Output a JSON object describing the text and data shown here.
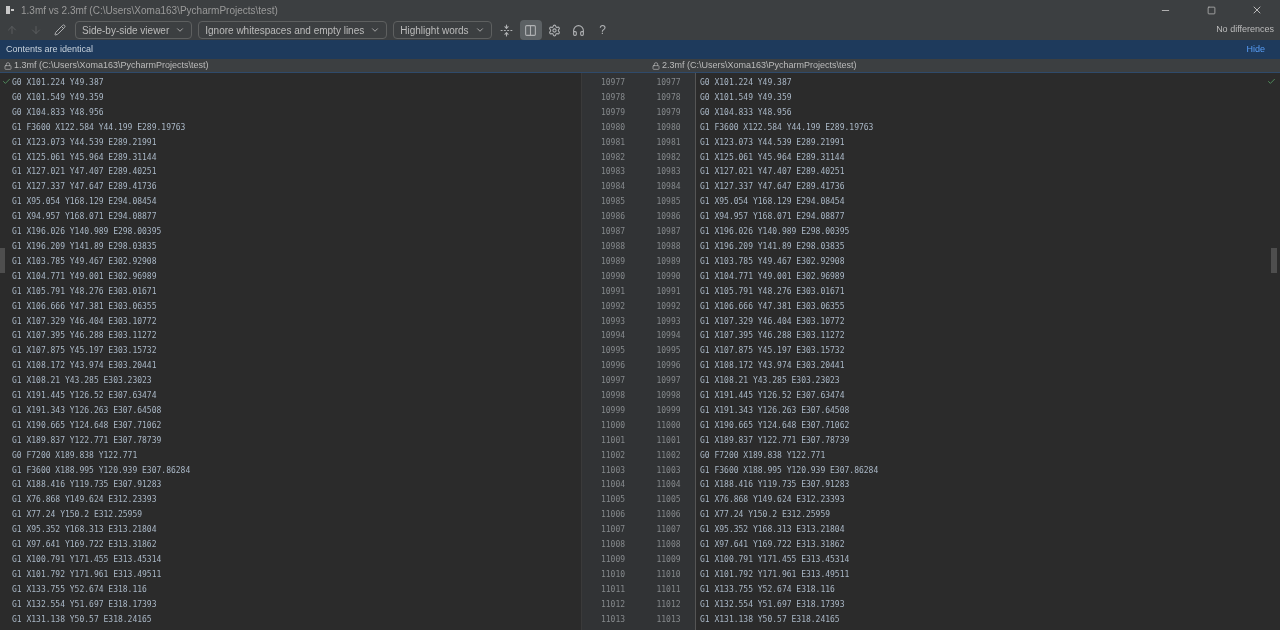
{
  "window": {
    "title": "1.3mf vs 2.3mf (C:\\Users\\Xoma163\\PycharmProjects\\test)"
  },
  "toolbar": {
    "items": [
      {
        "kind": "icon",
        "disabled": true
      },
      {
        "kind": "icon",
        "disabled": true
      },
      {
        "kind": "icon",
        "disabled": false
      },
      {
        "kind": "dropdown",
        "label": "Side-by-side viewer"
      },
      {
        "kind": "dropdown",
        "label": "Ignore whitespaces and empty lines"
      },
      {
        "kind": "dropdown",
        "label": "Highlight words"
      },
      {
        "kind": "toggle",
        "selected": false
      },
      {
        "kind": "toggle",
        "selected": true
      },
      {
        "kind": "icon",
        "disabled": false
      },
      {
        "kind": "icon",
        "disabled": false
      },
      {
        "kind": "text",
        "label": "?"
      }
    ],
    "status": "No differences"
  },
  "notification": {
    "message": "Contents are identical",
    "action": "Hide"
  },
  "left_file": "1.3mf (C:\\Users\\Xoma163\\PycharmProjects\\test)",
  "right_file": "2.3mf (C:\\Users\\Xoma163\\PycharmProjects\\test)",
  "lines": [
    {
      "left_no": "10977",
      "right_no": "10977",
      "left": "G0 X101.224 Y49.387",
      "right": "G0 X101.224 Y49.387"
    },
    {
      "left_no": "10978",
      "right_no": "10978",
      "left": "G0 X101.549 Y49.359",
      "right": "G0 X101.549 Y49.359"
    },
    {
      "left_no": "10979",
      "right_no": "10979",
      "left": "G0 X104.833 Y48.956",
      "right": "G0 X104.833 Y48.956"
    },
    {
      "left_no": "10980",
      "right_no": "10980",
      "left": "G1 F3600 X122.584 Y44.199 E289.19763",
      "right": "G1 F3600 X122.584 Y44.199 E289.19763"
    },
    {
      "left_no": "10981",
      "right_no": "10981",
      "left": "G1 X123.073 Y44.539 E289.21991",
      "right": "G1 X123.073 Y44.539 E289.21991"
    },
    {
      "left_no": "10982",
      "right_no": "10982",
      "left": "G1 X125.061 Y45.964 E289.31144",
      "right": "G1 X125.061 Y45.964 E289.31144"
    },
    {
      "left_no": "10983",
      "right_no": "10983",
      "left": "G1 X127.021 Y47.407 E289.40251",
      "right": "G1 X127.021 Y47.407 E289.40251"
    },
    {
      "left_no": "10984",
      "right_no": "10984",
      "left": "G1 X127.337 Y47.647 E289.41736",
      "right": "G1 X127.337 Y47.647 E289.41736"
    },
    {
      "left_no": "10985",
      "right_no": "10985",
      "left": "G1 X95.054 Y168.129 E294.08454",
      "right": "G1 X95.054 Y168.129 E294.08454"
    },
    {
      "left_no": "10986",
      "right_no": "10986",
      "left": "G1 X94.957 Y168.071 E294.08877",
      "right": "G1 X94.957 Y168.071 E294.08877"
    },
    {
      "left_no": "10987",
      "right_no": "10987",
      "left": "G1 X196.026 Y140.989 E298.00395",
      "right": "G1 X196.026 Y140.989 E298.00395"
    },
    {
      "left_no": "10988",
      "right_no": "10988",
      "left": "G1 X196.209 Y141.89 E298.03835",
      "right": "G1 X196.209 Y141.89 E298.03835"
    },
    {
      "left_no": "10989",
      "right_no": "10989",
      "left": "G1 X103.785 Y49.467 E302.92908",
      "right": "G1 X103.785 Y49.467 E302.92908"
    },
    {
      "left_no": "10990",
      "right_no": "10990",
      "left": "G1 X104.771 Y49.001 E302.96989",
      "right": "G1 X104.771 Y49.001 E302.96989"
    },
    {
      "left_no": "10991",
      "right_no": "10991",
      "left": "G1 X105.791 Y48.276 E303.01671",
      "right": "G1 X105.791 Y48.276 E303.01671"
    },
    {
      "left_no": "10992",
      "right_no": "10992",
      "left": "G1 X106.666 Y47.381 E303.06355",
      "right": "G1 X106.666 Y47.381 E303.06355"
    },
    {
      "left_no": "10993",
      "right_no": "10993",
      "left": "G1 X107.329 Y46.404 E303.10772",
      "right": "G1 X107.329 Y46.404 E303.10772"
    },
    {
      "left_no": "10994",
      "right_no": "10994",
      "left": "G1 X107.395 Y46.288 E303.11272",
      "right": "G1 X107.395 Y46.288 E303.11272"
    },
    {
      "left_no": "10995",
      "right_no": "10995",
      "left": "G1 X107.875 Y45.197 E303.15732",
      "right": "G1 X107.875 Y45.197 E303.15732"
    },
    {
      "left_no": "10996",
      "right_no": "10996",
      "left": "G1 X108.172 Y43.974 E303.20441",
      "right": "G1 X108.172 Y43.974 E303.20441"
    },
    {
      "left_no": "10997",
      "right_no": "10997",
      "left": "G1 X108.21 Y43.285 E303.23023",
      "right": "G1 X108.21 Y43.285 E303.23023"
    },
    {
      "left_no": "10998",
      "right_no": "10998",
      "left": "G1 X191.445 Y126.52 E307.63474",
      "right": "G1 X191.445 Y126.52 E307.63474"
    },
    {
      "left_no": "10999",
      "right_no": "10999",
      "left": "G1 X191.343 Y126.263 E307.64508",
      "right": "G1 X191.343 Y126.263 E307.64508"
    },
    {
      "left_no": "11000",
      "right_no": "11000",
      "left": "G1 X190.665 Y124.648 E307.71062",
      "right": "G1 X190.665 Y124.648 E307.71062"
    },
    {
      "left_no": "11001",
      "right_no": "11001",
      "left": "G1 X189.837 Y122.771 E307.78739",
      "right": "G1 X189.837 Y122.771 E307.78739"
    },
    {
      "left_no": "11002",
      "right_no": "11002",
      "left": "G0 F7200 X189.838 Y122.771",
      "right": "G0 F7200 X189.838 Y122.771"
    },
    {
      "left_no": "11003",
      "right_no": "11003",
      "left": "G1 F3600 X188.995 Y120.939 E307.86284",
      "right": "G1 F3600 X188.995 Y120.939 E307.86284"
    },
    {
      "left_no": "11004",
      "right_no": "11004",
      "left": "G1 X188.416 Y119.735 E307.91283",
      "right": "G1 X188.416 Y119.735 E307.91283"
    },
    {
      "left_no": "11005",
      "right_no": "11005",
      "left": "G1 X76.868 Y149.624 E312.23393",
      "right": "G1 X76.868 Y149.624 E312.23393"
    },
    {
      "left_no": "11006",
      "right_no": "11006",
      "left": "G1 X77.24 Y150.2 E312.25959",
      "right": "G1 X77.24 Y150.2 E312.25959"
    },
    {
      "left_no": "11007",
      "right_no": "11007",
      "left": "G1 X95.352 Y168.313 E313.21804",
      "right": "G1 X95.352 Y168.313 E313.21804"
    },
    {
      "left_no": "11008",
      "right_no": "11008",
      "left": "G1 X97.641 Y169.722 E313.31862",
      "right": "G1 X97.641 Y169.722 E313.31862"
    },
    {
      "left_no": "11009",
      "right_no": "11009",
      "left": "G1 X100.791 Y171.455 E313.45314",
      "right": "G1 X100.791 Y171.455 E313.45314"
    },
    {
      "left_no": "11010",
      "right_no": "11010",
      "left": "G1 X101.792 Y171.961 E313.49511",
      "right": "G1 X101.792 Y171.961 E313.49511"
    },
    {
      "left_no": "11011",
      "right_no": "11011",
      "left": "G1 X133.755 Y52.674 E318.116",
      "right": "G1 X133.755 Y52.674 E318.116"
    },
    {
      "left_no": "11012",
      "right_no": "11012",
      "left": "G1 X132.554 Y51.697 E318.17393",
      "right": "G1 X132.554 Y51.697 E318.17393"
    },
    {
      "left_no": "11013",
      "right_no": "11013",
      "left": "G1 X131.138 Y50.57 E318.24165",
      "right": "G1 X131.138 Y50.57 E318.24165"
    }
  ]
}
